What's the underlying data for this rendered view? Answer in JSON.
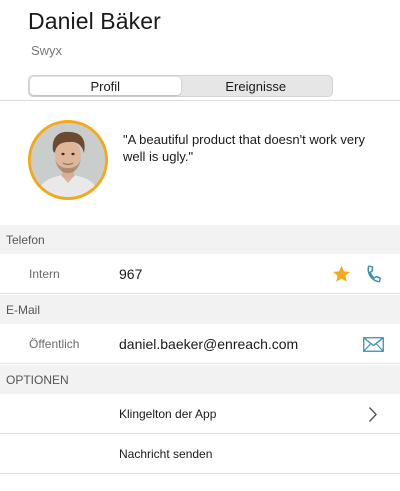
{
  "contact": {
    "name": "Daniel Bäker",
    "company": "Swyx",
    "quote": "\"A beautiful product that doesn't work very well is ugly.\""
  },
  "tabs": [
    {
      "label": "Profil",
      "active": true
    },
    {
      "label": "Ereignisse",
      "active": false
    }
  ],
  "phone": {
    "section_label": "Telefon",
    "entries": [
      {
        "label": "Intern",
        "value": "967",
        "favorite": true,
        "icons": [
          "star-icon",
          "phone-icon"
        ]
      }
    ]
  },
  "email": {
    "section_label": "E-Mail",
    "entries": [
      {
        "label": "Öffentlich",
        "value": "daniel.baeker@enreach.com",
        "icons": [
          "envelope-icon"
        ]
      }
    ]
  },
  "options": {
    "section_label": "OPTIONEN",
    "items": [
      {
        "label": "Klingelton der App",
        "icons": [
          "chevron-right-icon"
        ]
      },
      {
        "label": "Nachricht senden"
      }
    ]
  },
  "colors": {
    "accent": "#3a8fb7",
    "favorite": "#f5a81c",
    "avatar_ring": "#f5a81c",
    "section_background": "#f2f2f2"
  }
}
